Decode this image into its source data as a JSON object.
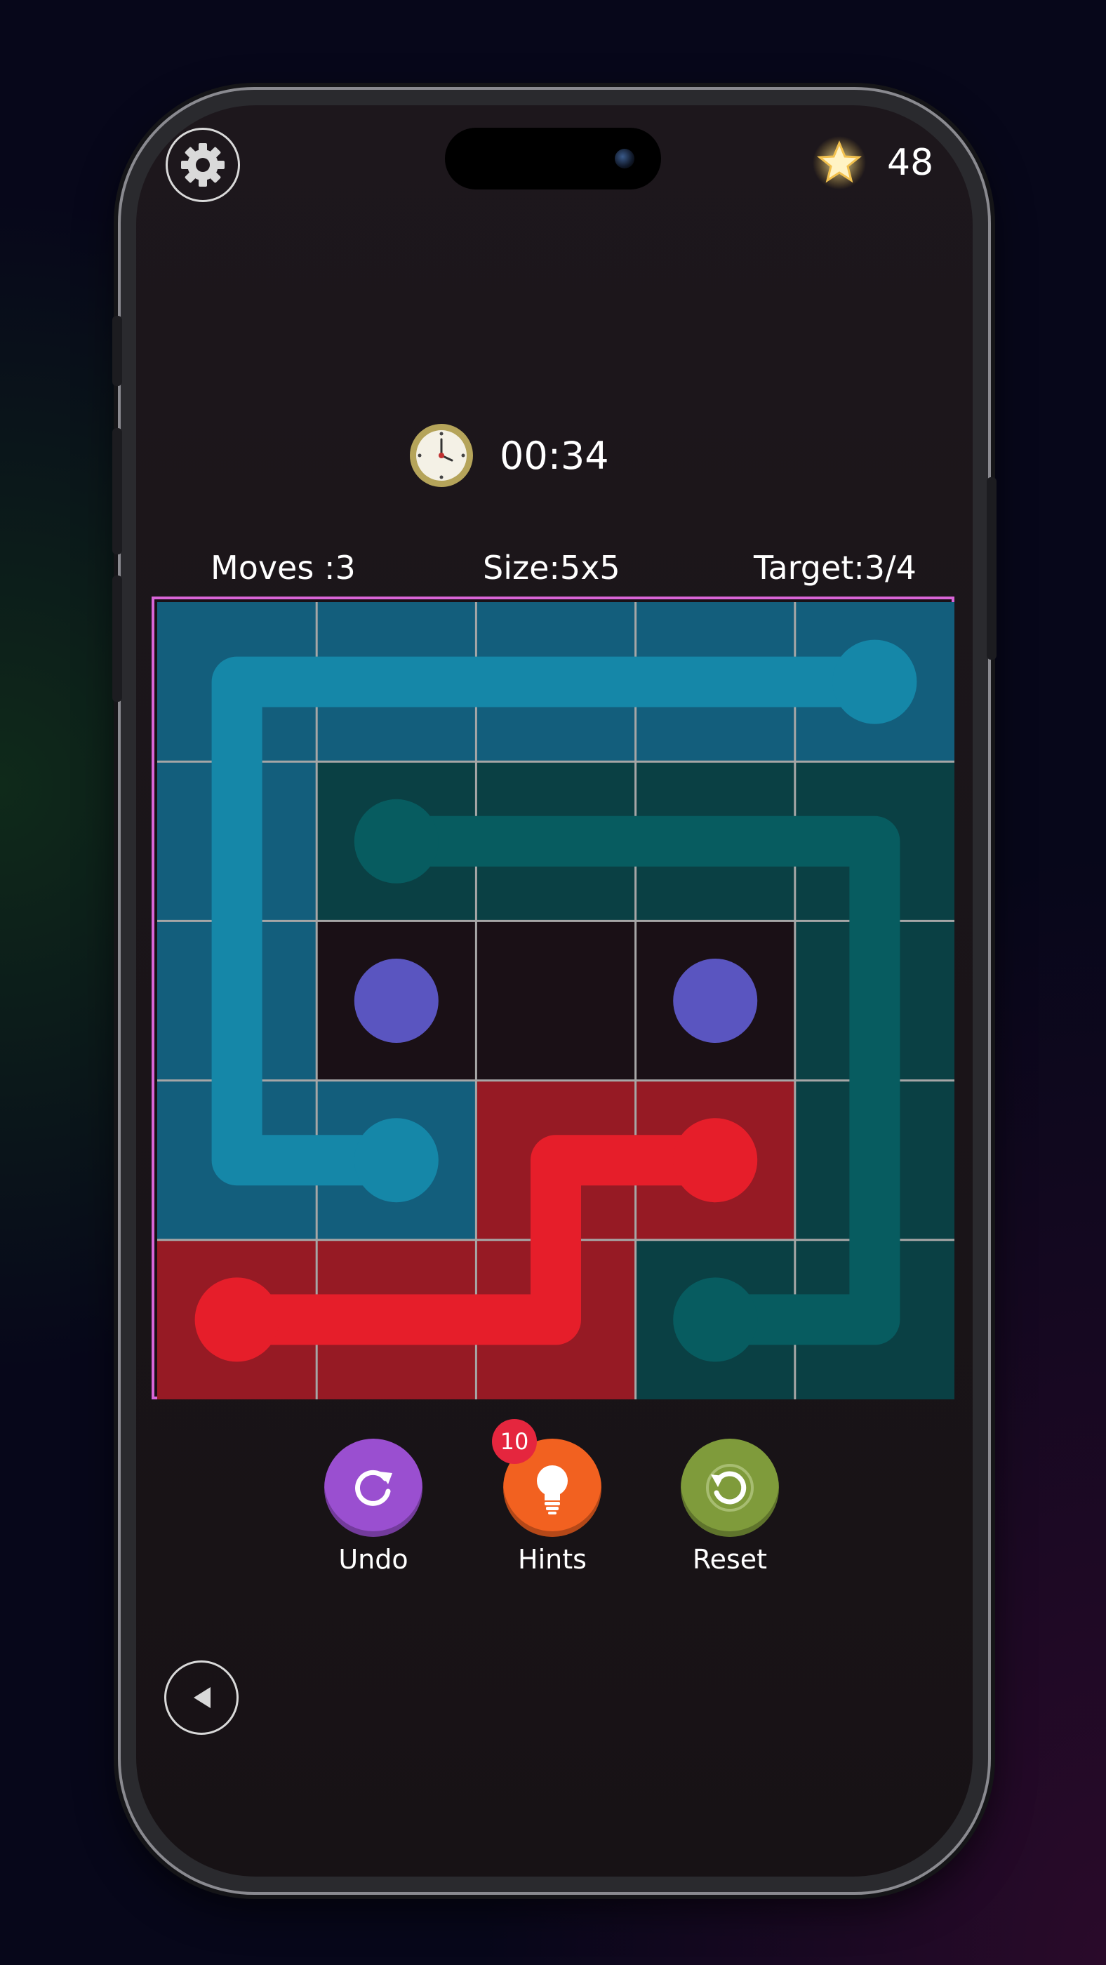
{
  "header": {
    "stars": "48"
  },
  "timer": {
    "text": "00:34"
  },
  "stats": {
    "moves": "Moves :3",
    "size": "Size:5x5",
    "target": "Target:3/4"
  },
  "board": {
    "rows": 5,
    "cols": 5,
    "colors": {
      "blue_line": "#1587a8",
      "blue_fill": "#135e7c",
      "teal_line": "#075c60",
      "teal_fill": "#0a4044",
      "red_line": "#e61e2a",
      "red_fill": "#961a24",
      "purple_dot": "#5a55c0",
      "empty": "#1a1016",
      "grid_line": "#a6a6a6",
      "border": "#d965d8"
    },
    "cell_fill": [
      [
        "blue",
        "blue",
        "blue",
        "blue",
        "blue"
      ],
      [
        "blue",
        "teal",
        "teal",
        "teal",
        "teal"
      ],
      [
        "blue",
        "empty",
        "empty",
        "empty",
        "teal"
      ],
      [
        "blue",
        "blue",
        "red",
        "red",
        "teal"
      ],
      [
        "red",
        "red",
        "red",
        "teal",
        "teal"
      ]
    ],
    "paths": [
      {
        "color": "blue",
        "cells": [
          [
            0,
            4
          ],
          [
            0,
            3
          ],
          [
            0,
            2
          ],
          [
            0,
            1
          ],
          [
            0,
            0
          ],
          [
            1,
            0
          ],
          [
            2,
            0
          ],
          [
            3,
            0
          ],
          [
            3,
            1
          ]
        ]
      },
      {
        "color": "teal",
        "cells": [
          [
            1,
            1
          ],
          [
            1,
            2
          ],
          [
            1,
            3
          ],
          [
            1,
            4
          ],
          [
            2,
            4
          ],
          [
            3,
            4
          ],
          [
            4,
            4
          ],
          [
            4,
            3
          ]
        ]
      },
      {
        "color": "red",
        "cells": [
          [
            3,
            3
          ],
          [
            3,
            2
          ],
          [
            4,
            2
          ],
          [
            4,
            1
          ],
          [
            4,
            0
          ]
        ]
      }
    ],
    "dots": [
      {
        "color": "purple",
        "cell": [
          2,
          1
        ]
      },
      {
        "color": "purple",
        "cell": [
          2,
          3
        ]
      }
    ]
  },
  "actions": {
    "undo": {
      "label": "Undo",
      "color": "#9a4fd0"
    },
    "hints": {
      "label": "Hints",
      "color": "#f26120",
      "badge": "10"
    },
    "reset": {
      "label": "Reset",
      "color": "#7f9b3b"
    }
  },
  "icons": {
    "settings": "gear-icon",
    "star": "star-icon",
    "timer": "clock-icon",
    "undo": "redo-arrow-icon",
    "hints": "lightbulb-icon",
    "reset": "reset-arrow-icon",
    "back": "back-triangle-icon"
  }
}
